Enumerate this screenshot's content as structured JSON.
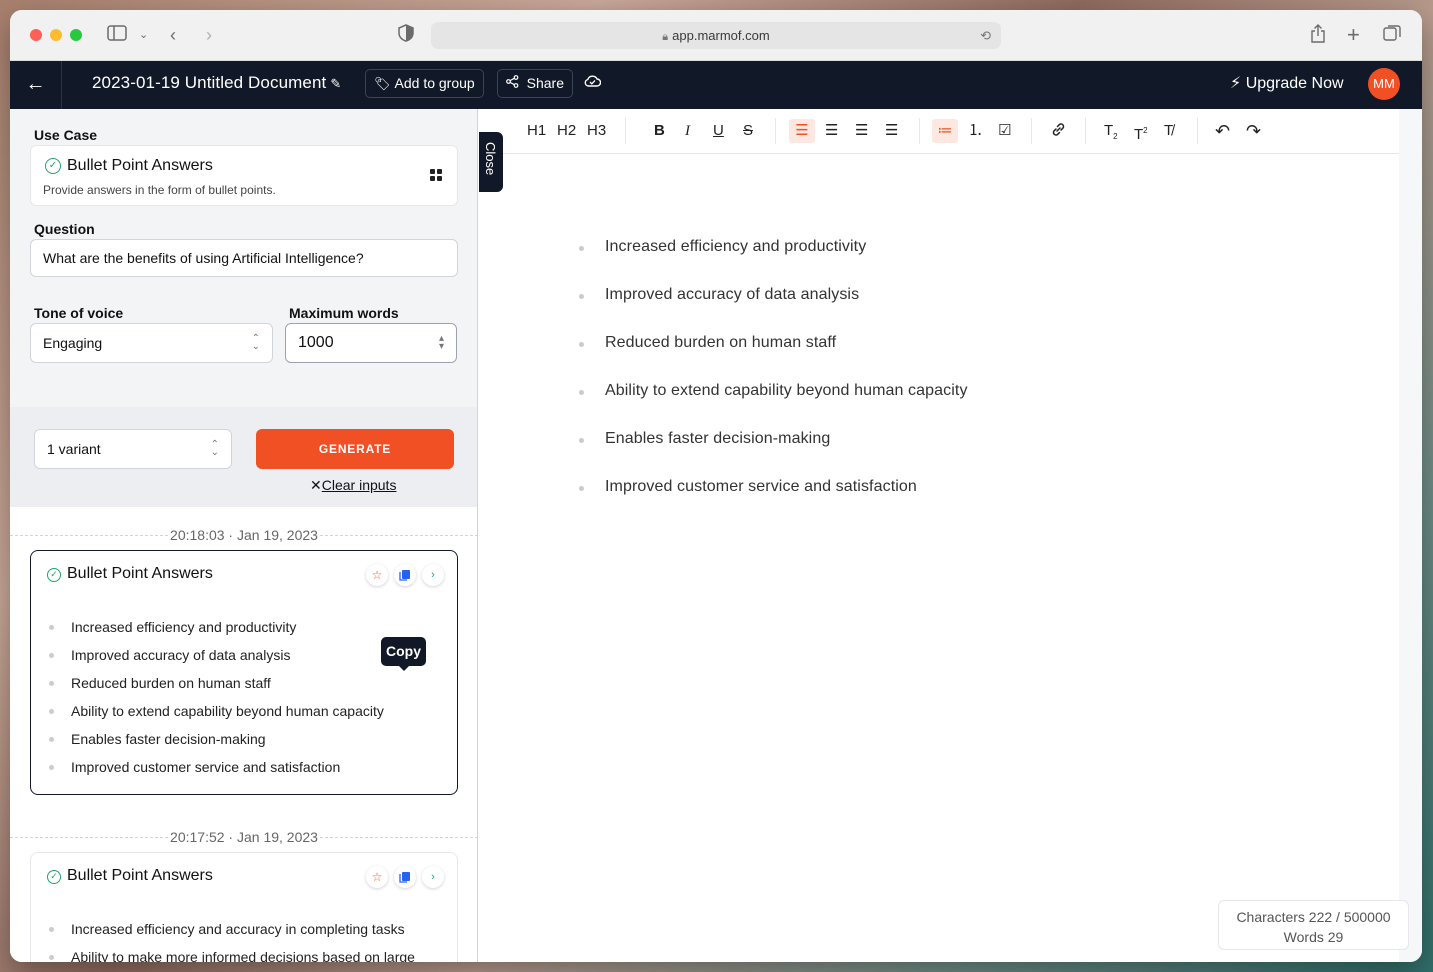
{
  "browser": {
    "url": "app.marmof.com"
  },
  "header": {
    "doc_title": "2023-01-19 Untitled Document",
    "add_to_group": "Add to group",
    "share": "Share",
    "upgrade": "Upgrade Now",
    "avatar_initials": "MM"
  },
  "form": {
    "use_case_label": "Use Case",
    "use_case_title": "Bullet Point Answers",
    "use_case_desc": "Provide answers in the form of bullet points.",
    "question_label": "Question",
    "question_value": "What are the benefits of using Artificial Intelligence?",
    "tone_label": "Tone of voice",
    "tone_value": "Engaging",
    "max_words_label": "Maximum words",
    "max_words_value": "1000",
    "variant_value": "1 variant",
    "generate": "GENERATE",
    "clear_inputs": "Clear inputs"
  },
  "results": [
    {
      "timestamp": "20:18:03 · Jan 19, 2023",
      "title": "Bullet Point Answers",
      "items": [
        "Increased efficiency and productivity",
        "Improved accuracy of data analysis",
        "Reduced burden on human staff",
        "Ability to extend capability beyond human capacity",
        "Enables faster decision-making",
        "Improved customer service and satisfaction"
      ]
    },
    {
      "timestamp": "20:17:52 · Jan 19, 2023",
      "title": "Bullet Point Answers",
      "items": [
        "Increased efficiency and accuracy in completing tasks",
        "Ability to make more informed decisions based on large"
      ]
    }
  ],
  "tooltip": "Copy",
  "close_tab": "Close",
  "toolbar": {
    "h1": "H1",
    "h2": "H2",
    "h3": "H3"
  },
  "editor": {
    "items": [
      "Increased efficiency and productivity",
      "Improved accuracy of data analysis",
      "Reduced burden on human staff",
      "Ability to extend capability beyond human capacity",
      "Enables faster decision-making",
      "Improved customer service and satisfaction"
    ]
  },
  "counter": {
    "characters": "Characters 222 / 500000",
    "words": "Words 29"
  },
  "colors": {
    "accent": "#f05023",
    "header_bg": "#111827",
    "success": "#22a36b",
    "copy_blue": "#2563eb"
  }
}
